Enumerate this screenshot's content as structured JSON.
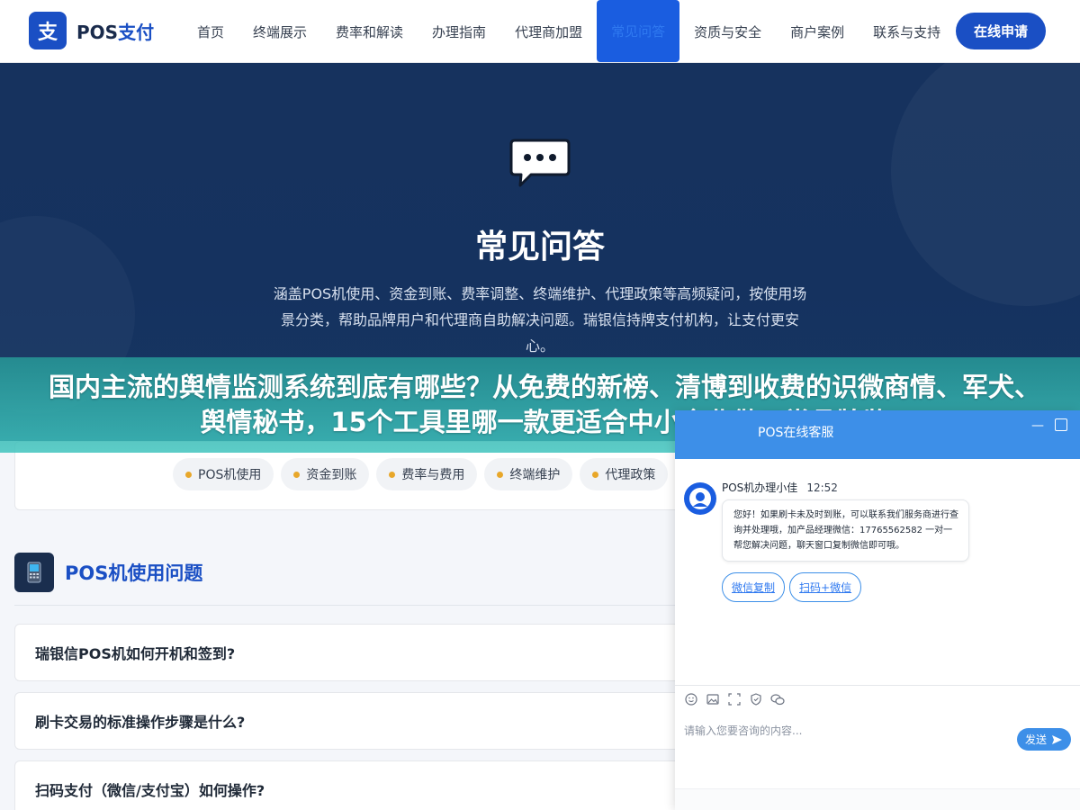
{
  "header": {
    "logo_mark": "支",
    "logo_text_a": "POS",
    "logo_text_b": "支付",
    "nav": [
      "首页",
      "终端展示",
      "费率和解读",
      "办理指南",
      "代理商加盟",
      "常见问答",
      "资质与安全",
      "商户案例",
      "联系与支持"
    ],
    "active_index": 5,
    "apply_label": "在线申请"
  },
  "hero": {
    "title": "常见问答",
    "description": "涵盖POS机使用、资金到账、费率调整、终端维护、代理政策等高频疑问，按使用场景分类，帮助品牌用户和代理商自助解决问题。瑞银信持牌支付机构，让支付更安心。"
  },
  "banner": {
    "headline": "国内主流的舆情监测系统到底有哪些？从免费的新榜、清博到收费的识微商情、军犬、舆情秘书，15个工具里哪一款更适合中小企业做日常品牌监"
  },
  "categories": [
    "POS机使用",
    "资金到账",
    "费率与费用",
    "终端维护",
    "代理政策"
  ],
  "section": {
    "title": "POS机使用问题"
  },
  "faqs": [
    "瑞银信POS机如何开机和签到?",
    "刷卡交易的标准操作步骤是什么?",
    "扫码支付（微信/支付宝）如何操作?"
  ],
  "chat": {
    "header_title": "POS在线客服",
    "agent_name": "POS机办理小佳",
    "time": "12:52",
    "message": "您好！如果刷卡未及时到账，可以联系我们服务商进行查询并处理哦，加产品经理微信：17765562582 一对一帮您解决问题，聊天窗口复制微信即可哦。",
    "actions": [
      "微信复制",
      "扫码+微信"
    ],
    "input_placeholder": "请输入您要咨询的内容...",
    "send_label": "发送",
    "accent_color": "#3d8fe8"
  }
}
